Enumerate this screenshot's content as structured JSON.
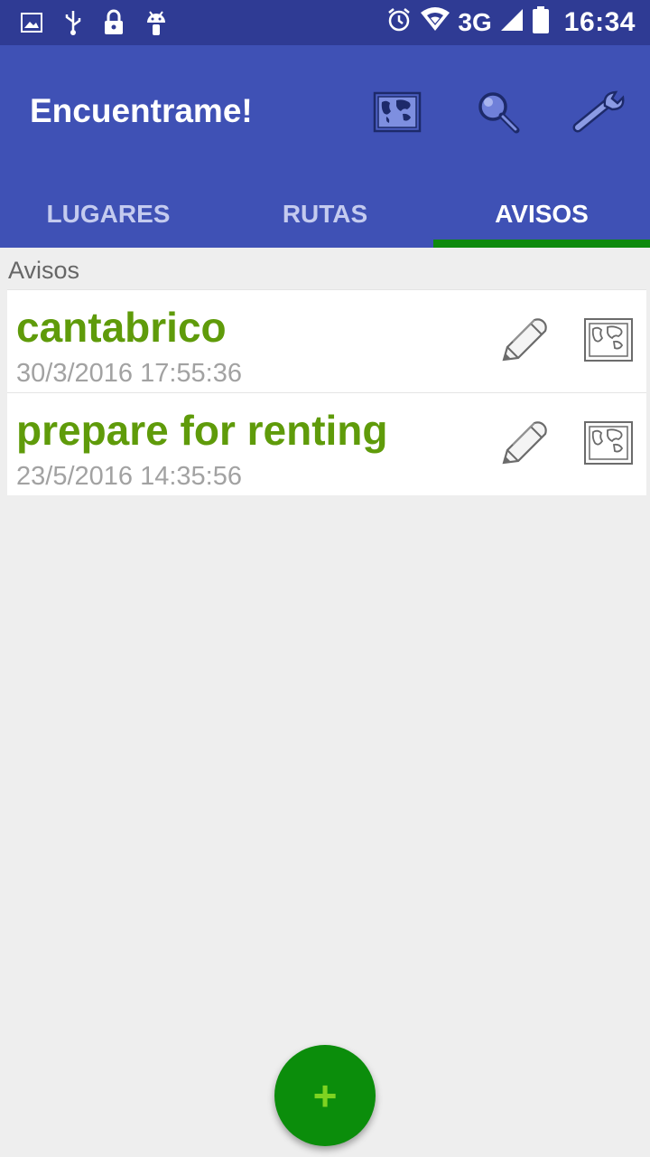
{
  "status_bar": {
    "time": "16:34",
    "network": "3G",
    "left_icons": [
      "image-icon",
      "usb-icon",
      "lock-icon",
      "android-icon"
    ],
    "right_icons": [
      "alarm-icon",
      "wifi-icon",
      "signal-icon",
      "battery-icon"
    ]
  },
  "appbar": {
    "title": "Encuentrame!",
    "actions": [
      "map-icon",
      "search-icon",
      "wrench-icon"
    ]
  },
  "tabs": [
    {
      "label": "LUGARES",
      "active": false
    },
    {
      "label": "RUTAS",
      "active": false
    },
    {
      "label": "AVISOS",
      "active": true
    }
  ],
  "section_label": "Avisos",
  "items": [
    {
      "title": "cantabrico",
      "date": "30/3/2016 17:55:36"
    },
    {
      "title": "prepare for renting",
      "date": "23/5/2016 14:35:56"
    }
  ],
  "fab": {
    "label": "+"
  },
  "colors": {
    "status_bar": "#2f3b94",
    "appbar": "#3f51b5",
    "tab_indicator": "#0e8a0e",
    "item_title": "#5f9b0a",
    "fab": "#0b8d0b"
  }
}
